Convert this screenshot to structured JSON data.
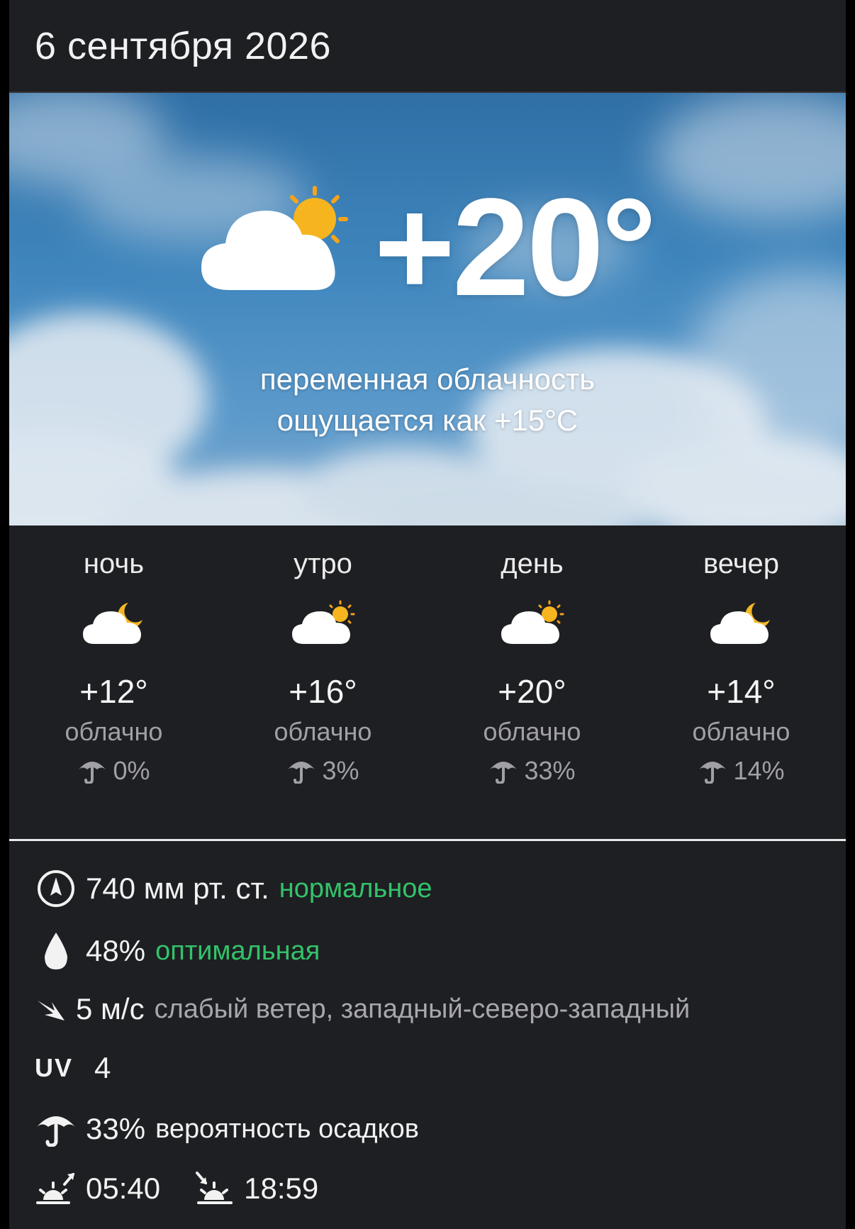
{
  "header": {
    "date": "6 сентября 2026"
  },
  "current": {
    "temperature": "+20°",
    "condition": "переменная облачность",
    "feels_like": "ощущается как +15°C",
    "icon": "cloud-sun-icon"
  },
  "periods": [
    {
      "name": "ночь",
      "icon": "cloud-moon-icon",
      "temp": "+12°",
      "condition": "облачно",
      "precip": "0%"
    },
    {
      "name": "утро",
      "icon": "cloud-sun-icon",
      "temp": "+16°",
      "condition": "облачно",
      "precip": "3%"
    },
    {
      "name": "день",
      "icon": "cloud-sun-icon",
      "temp": "+20°",
      "condition": "облачно",
      "precip": "33%"
    },
    {
      "name": "вечер",
      "icon": "cloud-moon-icon",
      "temp": "+14°",
      "condition": "облачно",
      "precip": "14%"
    }
  ],
  "details": {
    "pressure": {
      "value": "740 мм рт. ст.",
      "status": "нормальное",
      "icon": "compass-icon"
    },
    "humidity": {
      "value": "48%",
      "status": "оптимальная",
      "icon": "droplet-icon"
    },
    "wind": {
      "value": "5 м/с",
      "description": "слабый ветер, западный-северо-западный",
      "icon": "wind-arrow-icon"
    },
    "uv": {
      "label": "UV",
      "value": "4"
    },
    "precipitation": {
      "value": "33%",
      "description": "вероятность осадков",
      "icon": "umbrella-icon"
    },
    "sunrise": {
      "value": "05:40",
      "icon": "sunrise-icon"
    },
    "sunset": {
      "value": "18:59",
      "icon": "sunset-icon"
    }
  },
  "colors": {
    "background": "#1e1f22",
    "accent_green": "#33c26a",
    "secondary_text": "#a0a0a6"
  }
}
